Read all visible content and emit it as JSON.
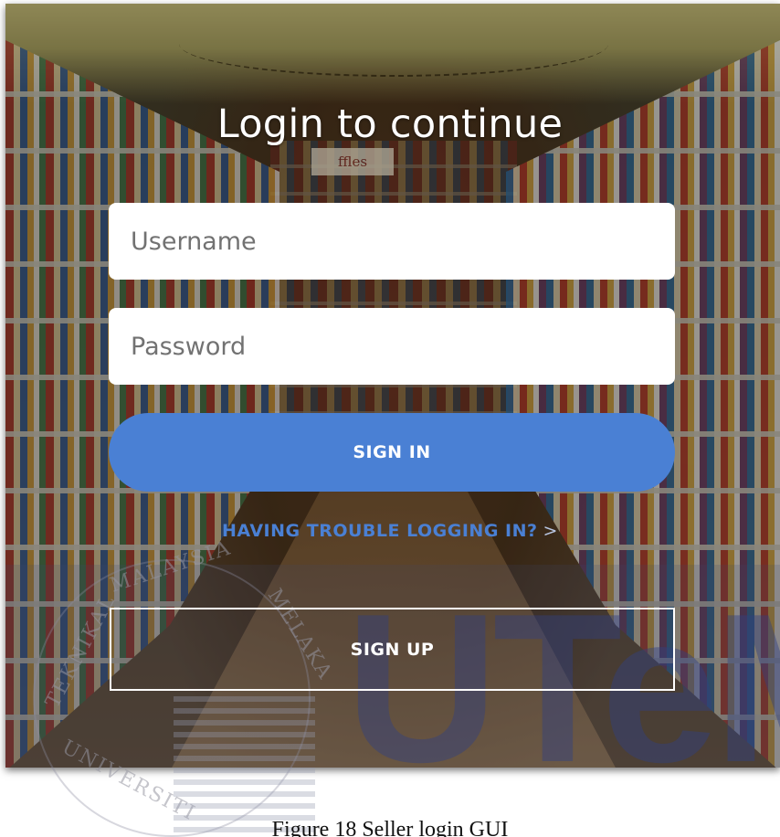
{
  "login": {
    "title": "Login to continue",
    "username_placeholder": "Username",
    "password_placeholder": "Password",
    "signin_label": "SIGN IN",
    "trouble_label": "HAVING TROUBLE LOGGING IN?",
    "trouble_chevron": ">",
    "signup_label": "SIGN UP"
  },
  "background": {
    "shelf_sign": "ffles"
  },
  "watermark": {
    "seal_text_top": "MALAYSIA",
    "seal_text_left": "TEKNIKAL",
    "seal_text_right": "MELAKA",
    "seal_text_bottom": "UNIVERSITI",
    "logo_text": "UTeM"
  },
  "caption": "Figure 18 Seller login GUI",
  "colors": {
    "accent": "#4a80d4",
    "field_bg": "#ffffff",
    "title_text": "#ffffff"
  }
}
